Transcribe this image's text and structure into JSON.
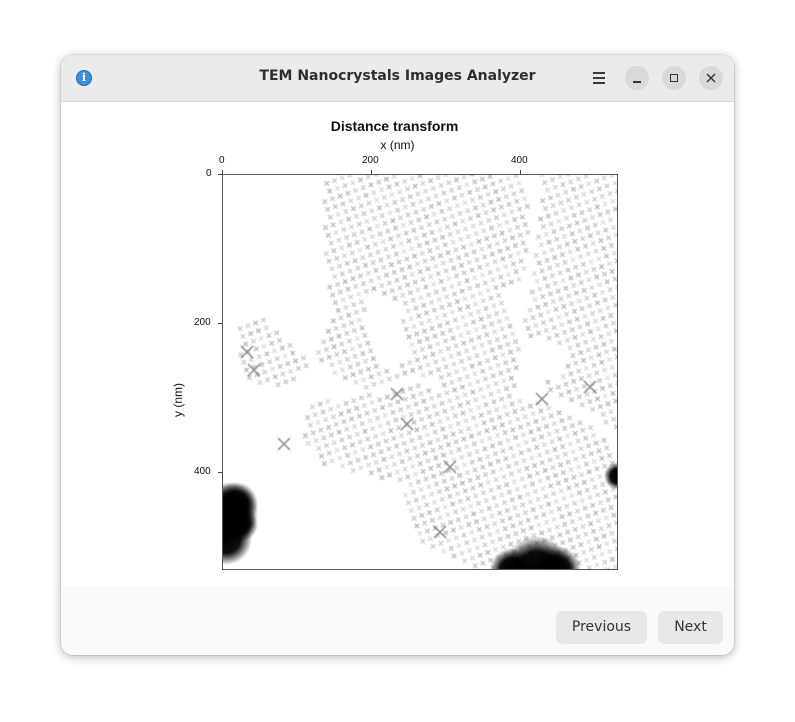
{
  "window": {
    "title": "TEM Nanocrystals Images Analyzer",
    "icons": {
      "info": "info-icon",
      "menu": "hamburger-menu-icon",
      "minimize": "minimize-icon",
      "maximize": "maximize-icon",
      "close": "close-icon"
    },
    "info_glyph": "i"
  },
  "figure": {
    "title": "Distance transform",
    "xlabel": "x (nm)",
    "ylabel": "y (nm)",
    "x_ticks": [
      "0",
      "200",
      "400"
    ],
    "y_ticks": [
      "0",
      "200",
      "400"
    ],
    "image_description": "grayscale distance transform of nanocrystal superlattice; white background, gray lattice of X-shaped marks, black blobs at lower-left and bottom edge"
  },
  "chart_data": {
    "type": "heatmap",
    "title": "Distance transform",
    "xlabel": "x (nm)",
    "ylabel": "y (nm)",
    "x_ticks": [
      0,
      200,
      400
    ],
    "y_ticks": [
      0,
      200,
      400
    ],
    "xlim": [
      0,
      532
    ],
    "ylim": [
      532,
      0
    ],
    "x_axis_position": "top",
    "colormap": "gray",
    "grid": false
  },
  "footer": {
    "previous_label": "Previous",
    "next_label": "Next"
  }
}
